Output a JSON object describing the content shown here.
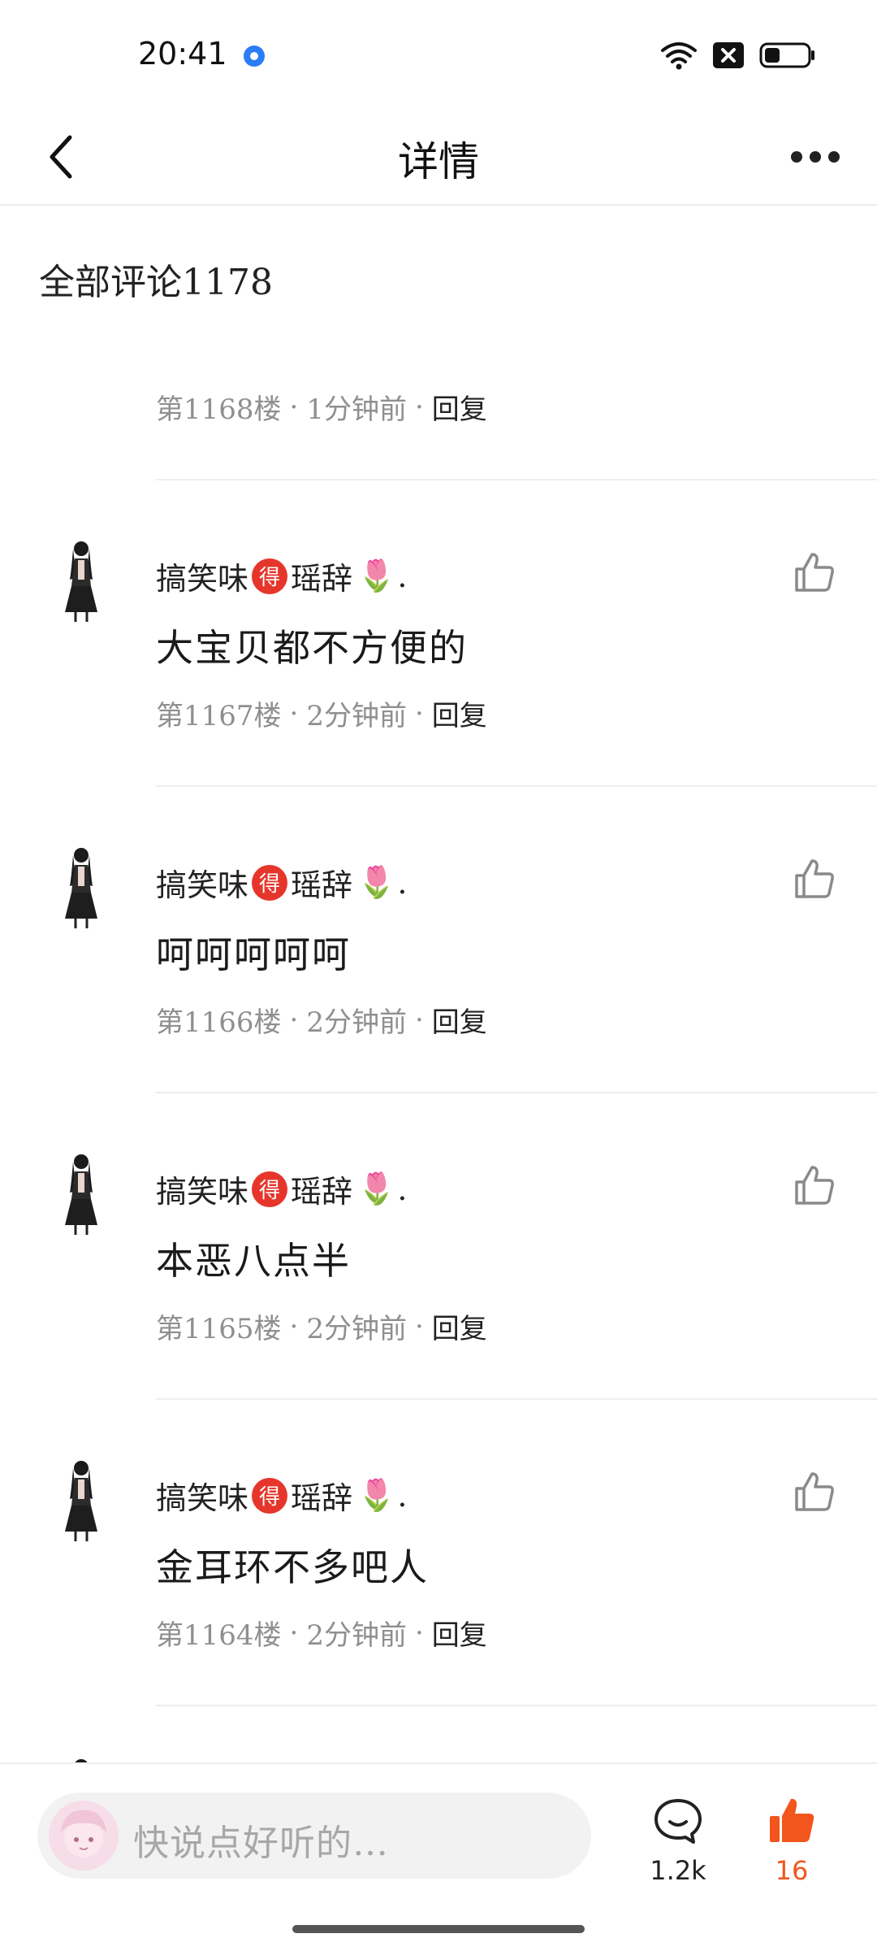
{
  "status_bar": {
    "time": "20:41",
    "icons": [
      "location-dot-icon",
      "wifi-icon",
      "sim-disabled-icon",
      "battery-icon"
    ]
  },
  "nav": {
    "title": "详情",
    "back_icon": "chevron-left-icon",
    "more_icon": "more-dots-icon"
  },
  "comments_header": {
    "title": "全部评论1178"
  },
  "comments": [
    {
      "partial": true,
      "floor": "第1168楼",
      "time": "1分钟前",
      "reply": "回复"
    },
    {
      "name_part1": "搞笑味",
      "badge": "得",
      "name_part2": "瑶辞",
      "emoji": "🌷",
      "name_suffix": ".",
      "text": "大宝贝都不方便的",
      "floor": "第1167楼",
      "time": "2分钟前",
      "reply": "回复"
    },
    {
      "name_part1": "搞笑味",
      "badge": "得",
      "name_part2": "瑶辞",
      "emoji": "🌷",
      "name_suffix": ".",
      "text": "呵呵呵呵呵",
      "floor": "第1166楼",
      "time": "2分钟前",
      "reply": "回复"
    },
    {
      "name_part1": "搞笑味",
      "badge": "得",
      "name_part2": "瑶辞",
      "emoji": "🌷",
      "name_suffix": ".",
      "text": "本恶八点半",
      "floor": "第1165楼",
      "time": "2分钟前",
      "reply": "回复"
    },
    {
      "name_part1": "搞笑味",
      "badge": "得",
      "name_part2": "瑶辞",
      "emoji": "🌷",
      "name_suffix": ".",
      "text": "金耳环不多吧人",
      "floor": "第1164楼",
      "time": "2分钟前",
      "reply": "回复"
    }
  ],
  "meta_separator": "·",
  "bottom_bar": {
    "input_placeholder": "快说点好听的…",
    "comment_count": "1.2k",
    "like_count": "16",
    "accent_color": "#f2561d"
  }
}
